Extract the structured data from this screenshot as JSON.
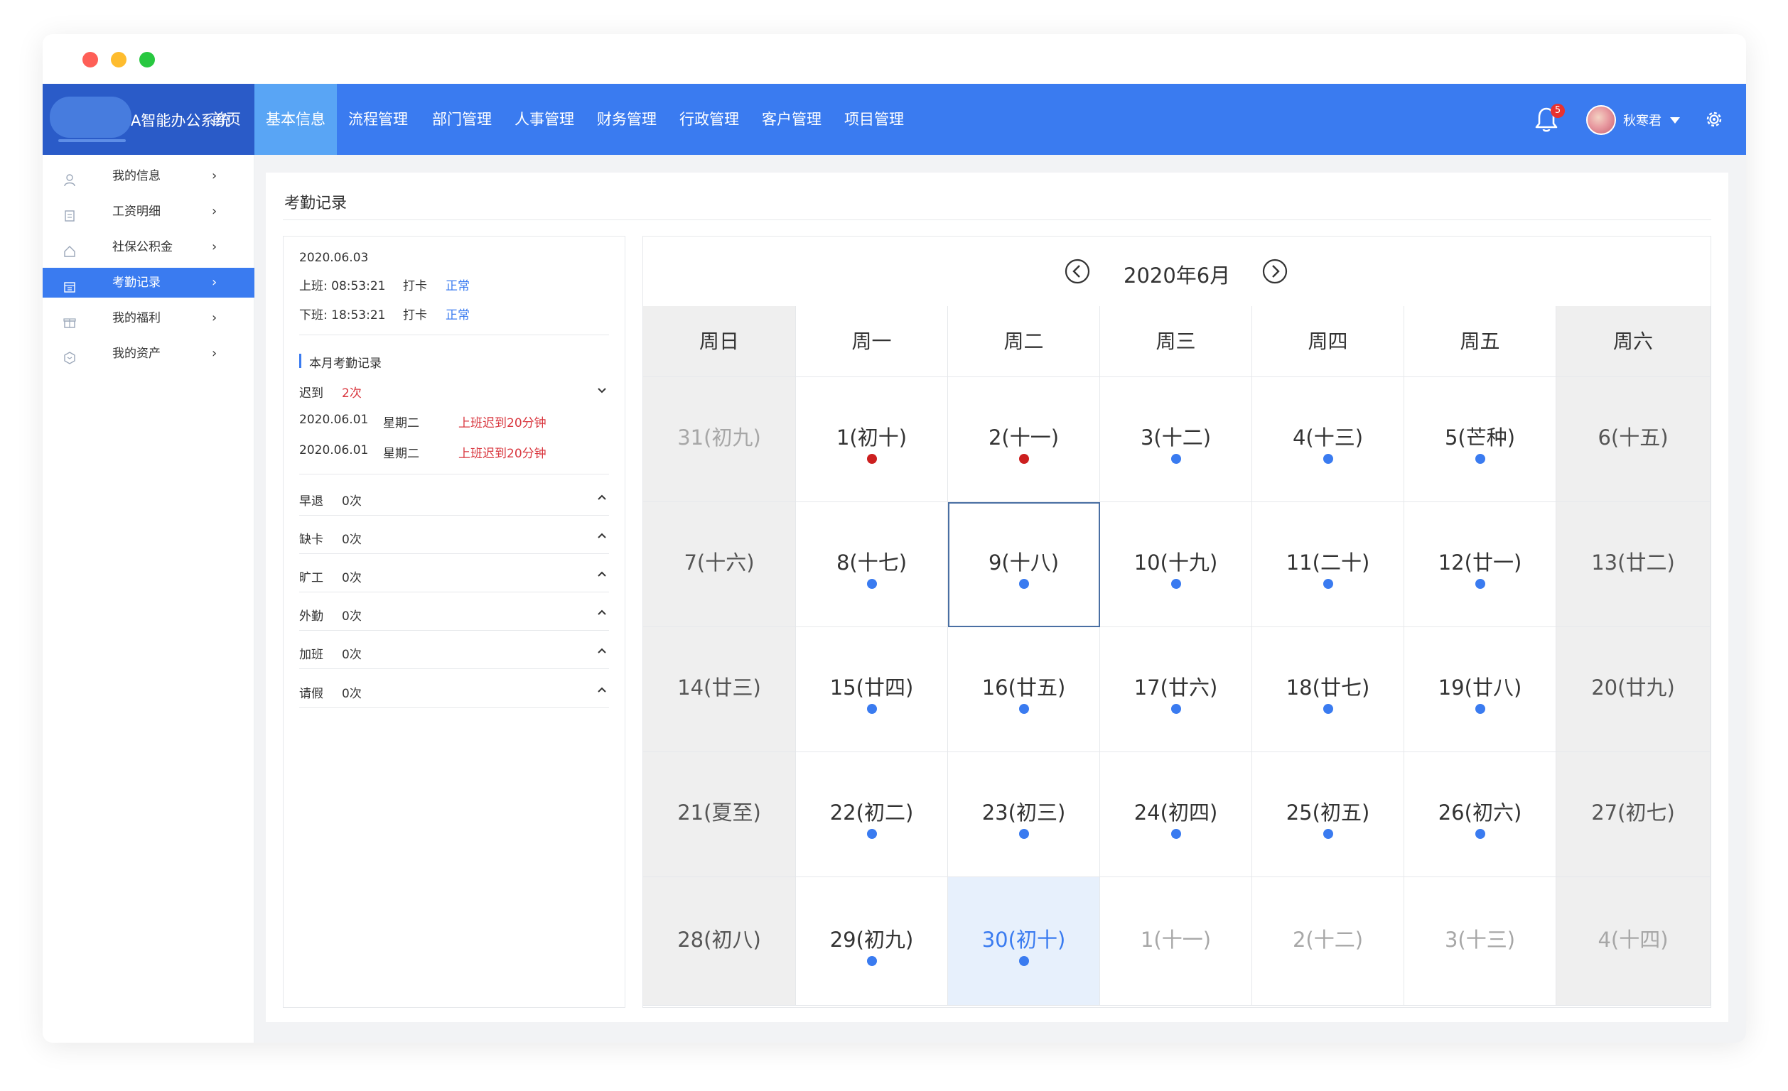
{
  "brand": {
    "name": "A智能办公系统"
  },
  "nav": [
    {
      "label": "首页",
      "active": false
    },
    {
      "label": "基本信息",
      "active": true
    },
    {
      "label": "流程管理",
      "active": false
    },
    {
      "label": "部门管理",
      "active": false
    },
    {
      "label": "人事管理",
      "active": false
    },
    {
      "label": "财务管理",
      "active": false
    },
    {
      "label": "行政管理",
      "active": false
    },
    {
      "label": "客户管理",
      "active": false
    },
    {
      "label": "项目管理",
      "active": false
    }
  ],
  "header": {
    "notification_count": "5",
    "username": "秋寒君"
  },
  "sidebar": {
    "items": [
      {
        "label": "我的信息",
        "arrow": "›",
        "icon": "user-icon",
        "active": false
      },
      {
        "label": "工资明细",
        "arrow": "›",
        "icon": "document-icon",
        "active": false
      },
      {
        "label": "社保公积金",
        "arrow": "›",
        "icon": "home-icon",
        "active": false
      },
      {
        "label": "考勤记录",
        "arrow": "›",
        "icon": "calendar-icon",
        "active": true
      },
      {
        "label": "我的福利",
        "arrow": "›",
        "icon": "gift-icon",
        "active": false
      },
      {
        "label": "我的资产",
        "arrow": "›",
        "icon": "shield-icon",
        "active": false
      }
    ]
  },
  "page": {
    "title": "考勤记录"
  },
  "today_record": {
    "date": "2020.06.03",
    "checkin": {
      "label": "上班: 08:53:21",
      "action": "打卡",
      "status": "正常"
    },
    "checkout": {
      "label": "下班: 18:53:21",
      "action": "打卡",
      "status": "正常"
    }
  },
  "monthly": {
    "title": "本月考勤记录",
    "late": {
      "label": "迟到",
      "count": "2次",
      "entries": [
        {
          "date": "2020.06.01",
          "weekday": "星期二",
          "note": "上班迟到20分钟"
        },
        {
          "date": "2020.06.01",
          "weekday": "星期二",
          "note": "上班迟到20分钟"
        }
      ]
    },
    "others": [
      {
        "label": "早退",
        "count": "0次"
      },
      {
        "label": "缺卡",
        "count": "0次"
      },
      {
        "label": "旷工",
        "count": "0次"
      },
      {
        "label": "外勤",
        "count": "0次"
      },
      {
        "label": "加班",
        "count": "0次"
      },
      {
        "label": "请假",
        "count": "0次"
      }
    ]
  },
  "calendar": {
    "month_label": "2020年6月",
    "weekdays": [
      "周日",
      "周一",
      "周二",
      "周三",
      "周四",
      "周五",
      "周六"
    ],
    "weeks": [
      [
        {
          "label": "31(初九)",
          "state": "other",
          "mark": "none"
        },
        {
          "label": "1(初十)",
          "state": "normal",
          "mark": "red"
        },
        {
          "label": "2(十一)",
          "state": "normal",
          "mark": "red"
        },
        {
          "label": "3(十二)",
          "state": "normal",
          "mark": "blue"
        },
        {
          "label": "4(十三)",
          "state": "normal",
          "mark": "blue"
        },
        {
          "label": "5(芒种)",
          "state": "normal",
          "mark": "blue"
        },
        {
          "label": "6(十五)",
          "state": "normal",
          "mark": "none"
        }
      ],
      [
        {
          "label": "7(十六)",
          "state": "normal",
          "mark": "none"
        },
        {
          "label": "8(十七)",
          "state": "normal",
          "mark": "blue"
        },
        {
          "label": "9(十八)",
          "state": "selected",
          "mark": "blue"
        },
        {
          "label": "10(十九)",
          "state": "normal",
          "mark": "blue"
        },
        {
          "label": "11(二十)",
          "state": "normal",
          "mark": "blue"
        },
        {
          "label": "12(廿一)",
          "state": "normal",
          "mark": "blue"
        },
        {
          "label": "13(廿二)",
          "state": "normal",
          "mark": "none"
        }
      ],
      [
        {
          "label": "14(廿三)",
          "state": "normal",
          "mark": "none"
        },
        {
          "label": "15(廿四)",
          "state": "normal",
          "mark": "blue"
        },
        {
          "label": "16(廿五)",
          "state": "normal",
          "mark": "blue"
        },
        {
          "label": "17(廿六)",
          "state": "normal",
          "mark": "blue"
        },
        {
          "label": "18(廿七)",
          "state": "normal",
          "mark": "blue"
        },
        {
          "label": "19(廿八)",
          "state": "normal",
          "mark": "blue"
        },
        {
          "label": "20(廿九)",
          "state": "normal",
          "mark": "none"
        }
      ],
      [
        {
          "label": "21(夏至)",
          "state": "normal",
          "mark": "none"
        },
        {
          "label": "22(初二)",
          "state": "normal",
          "mark": "blue"
        },
        {
          "label": "23(初三)",
          "state": "normal",
          "mark": "blue"
        },
        {
          "label": "24(初四)",
          "state": "normal",
          "mark": "blue"
        },
        {
          "label": "25(初五)",
          "state": "normal",
          "mark": "blue"
        },
        {
          "label": "26(初六)",
          "state": "normal",
          "mark": "blue"
        },
        {
          "label": "27(初七)",
          "state": "normal",
          "mark": "none"
        }
      ],
      [
        {
          "label": "28(初八)",
          "state": "normal",
          "mark": "none"
        },
        {
          "label": "29(初九)",
          "state": "normal",
          "mark": "blue"
        },
        {
          "label": "30(初十)",
          "state": "today",
          "mark": "blue"
        },
        {
          "label": "1(十一)",
          "state": "other",
          "mark": "none"
        },
        {
          "label": "2(十二)",
          "state": "other",
          "mark": "none"
        },
        {
          "label": "3(十三)",
          "state": "other",
          "mark": "none"
        },
        {
          "label": "4(十四)",
          "state": "other",
          "mark": "none"
        }
      ]
    ]
  },
  "colors": {
    "nav_bg": "#3a7bf0",
    "nav_active": "#59a5f5",
    "brand_bg": "#2a5bc8",
    "accent_blue": "#3a7bf0",
    "late_red": "#d9363e",
    "mark_red": "#cc1f1f",
    "weekend_bg": "#efefef",
    "today_bg": "#e7f0fc"
  }
}
